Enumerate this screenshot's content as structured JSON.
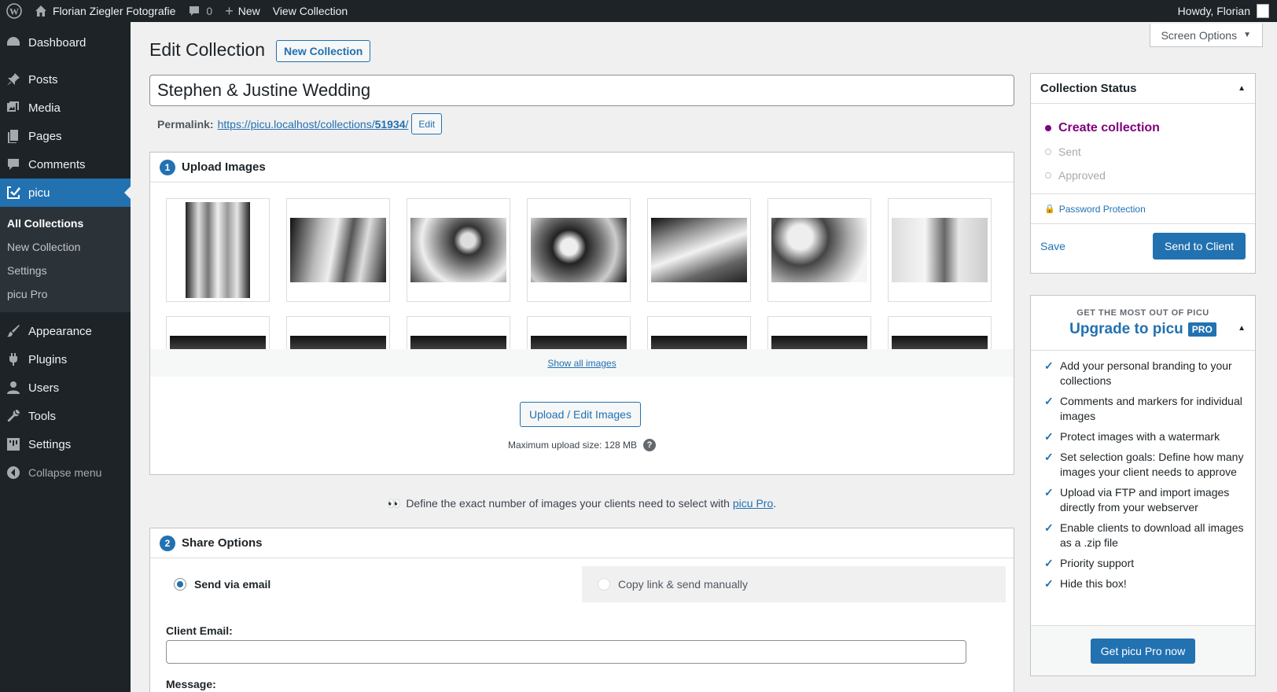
{
  "adminbar": {
    "site_name": "Florian Ziegler Fotografie",
    "comments_count": "0",
    "new_label": "New",
    "view_label": "View Collection",
    "howdy": "Howdy, Florian"
  },
  "sidebar": {
    "items_top": [
      {
        "label": "Dashboard",
        "icon": "dashboard-icon"
      },
      {
        "label": "Posts",
        "icon": "pin-icon"
      },
      {
        "label": "Media",
        "icon": "media-icon"
      },
      {
        "label": "Pages",
        "icon": "pages-icon"
      },
      {
        "label": "Comments",
        "icon": "comment-icon"
      },
      {
        "label": "picu",
        "icon": "picu-icon"
      }
    ],
    "submenu": [
      "All Collections",
      "New Collection",
      "Settings",
      "picu Pro"
    ],
    "items_bottom": [
      {
        "label": "Appearance",
        "icon": "brush-icon"
      },
      {
        "label": "Plugins",
        "icon": "plug-icon"
      },
      {
        "label": "Users",
        "icon": "user-icon"
      },
      {
        "label": "Tools",
        "icon": "wrench-icon"
      },
      {
        "label": "Settings",
        "icon": "settings-icon"
      }
    ],
    "collapse": "Collapse menu"
  },
  "screen_options": "Screen Options",
  "page": {
    "title": "Edit Collection",
    "new_button": "New Collection",
    "collection_title": "Stephen & Justine Wedding",
    "permalink_label": "Permalink:",
    "permalink_base": "https://picu.localhost/collections/",
    "permalink_slug": "51934",
    "permalink_trail": "/",
    "permalink_edit": "Edit"
  },
  "upload": {
    "step": "1",
    "heading": "Upload Images",
    "show_all": "Show all images",
    "upload_button": "Upload / Edit Images",
    "max_size": "Maximum upload size: 128 MB",
    "help": "?"
  },
  "promo": {
    "eyes": "👀",
    "text": "Define the exact number of images your clients need to select with ",
    "link": "picu Pro",
    "end": "."
  },
  "share": {
    "step": "2",
    "heading": "Share Options",
    "tab_email": "Send via email",
    "tab_manual": "Copy link & send manually",
    "client_email_label": "Client Email:",
    "client_email_value": "",
    "message_label": "Message:"
  },
  "status": {
    "heading": "Collection Status",
    "steps": [
      "Create collection",
      "Sent",
      "Approved"
    ],
    "password": "Password Protection",
    "save": "Save",
    "send": "Send to Client"
  },
  "pro": {
    "kicker": "GET THE MOST OUT OF PICU",
    "title": "Upgrade to picu",
    "badge": "PRO",
    "features": [
      "Add your personal branding to your collections",
      "Comments and markers for individual images",
      "Protect images with a watermark",
      "Set selection goals: Define how many images your client needs to approve",
      "Upload via FTP and import images directly from your webserver",
      "Enable clients to download all images as a .zip file",
      "Priority support",
      "Hide this box!"
    ],
    "cta": "Get picu Pro now"
  },
  "colors": {
    "accent": "#2271b1",
    "admin_dark": "#1d2327",
    "status_current": "#800080"
  }
}
